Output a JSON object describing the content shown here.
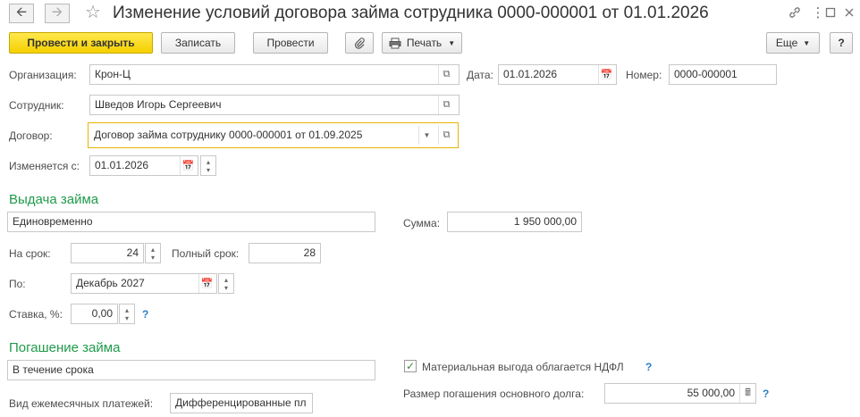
{
  "window": {
    "title": "Изменение условий договора займа сотрудника 0000-000001 от 01.01.2026"
  },
  "toolbar": {
    "post_close_label": "Провести и закрыть",
    "save_label": "Записать",
    "post_label": "Провести",
    "print_label": "Печать",
    "more_label": "Еще",
    "help_label": "?"
  },
  "header": {
    "org_label": "Организация:",
    "org_value": "Крон-Ц",
    "date_label": "Дата:",
    "date_value": "01.01.2026",
    "number_label": "Номер:",
    "number_value": "0000-000001",
    "employee_label": "Сотрудник:",
    "employee_value": "Шведов Игорь Сергеевич",
    "contract_label": "Договор:",
    "contract_value": "Договор займа сотруднику 0000-000001 от 01.09.2025",
    "changes_from_label": "Изменяется с:",
    "changes_from_value": "01.01.2026"
  },
  "issue": {
    "section_title": "Выдача займа",
    "method_value": "Единовременно",
    "amount_label": "Сумма:",
    "amount_value": "1 950 000,00",
    "term_label": "На срок:",
    "term_value": "24",
    "full_term_label": "Полный срок:",
    "full_term_value": "28",
    "until_label": "По:",
    "until_value": "Декабрь 2027",
    "rate_label": "Ставка, %:",
    "rate_value": "0,00",
    "help_mark": "?"
  },
  "repayment": {
    "section_title": "Погашение займа",
    "method_value": "В течение срока",
    "benefit_checkbox_label": "Материальная выгода облагается НДФЛ",
    "benefit_checked": true,
    "monthly_type_label": "Вид ежемесячных платежей:",
    "monthly_type_value": "Дифференцированные пл",
    "principal_label": "Размер погашения основного долга:",
    "principal_value": "55 000,00",
    "help_mark": "?"
  }
}
